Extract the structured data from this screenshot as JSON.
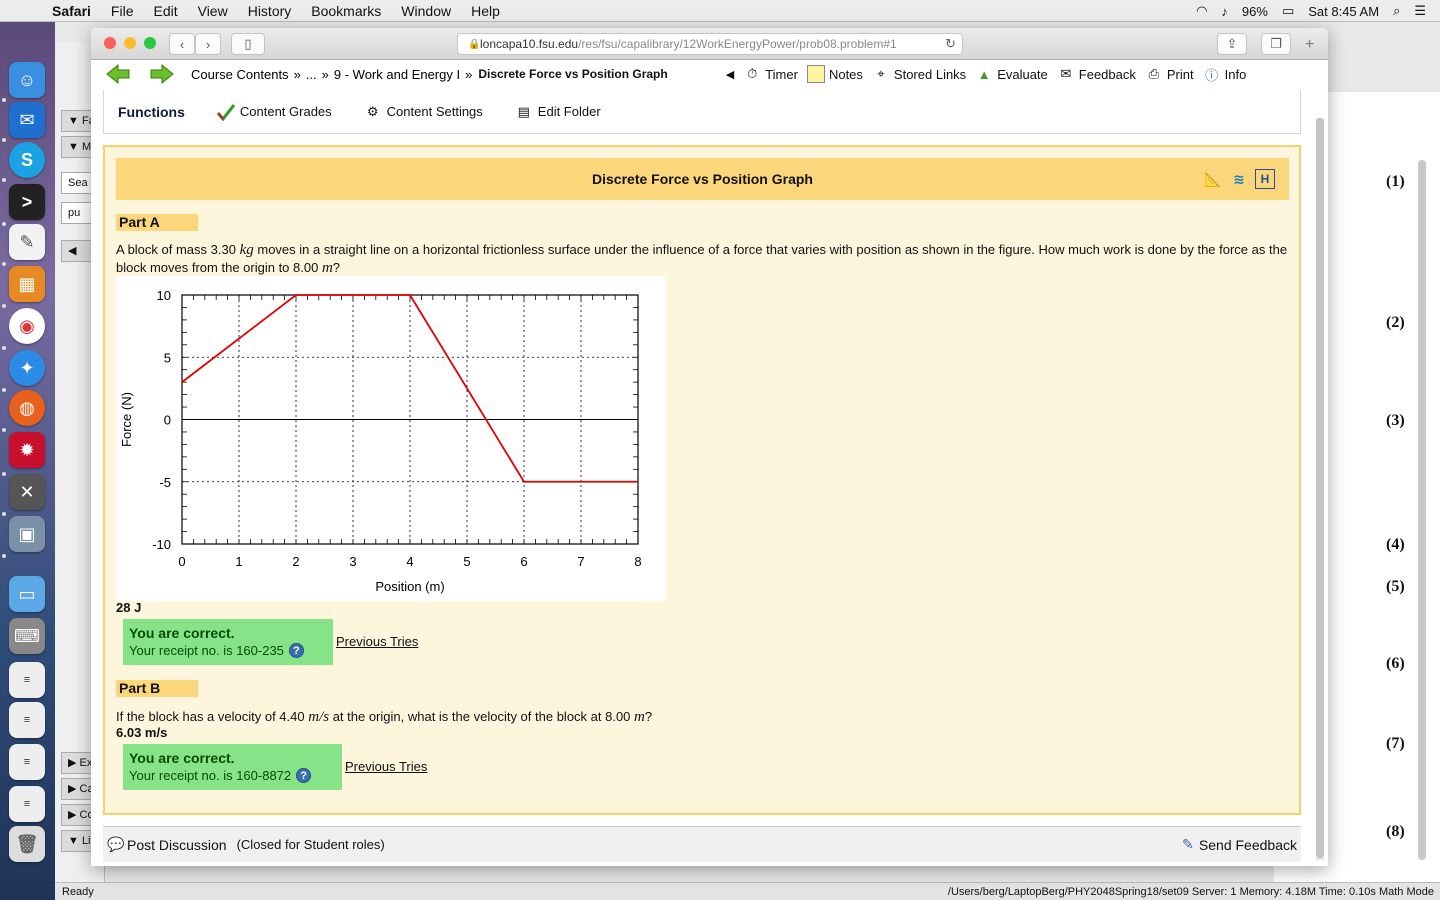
{
  "menubar": {
    "app": "Safari",
    "items": [
      "File",
      "Edit",
      "View",
      "History",
      "Bookmarks",
      "Window",
      "Help"
    ],
    "battery": "96%",
    "clock": "Sat 8:45 AM"
  },
  "browser": {
    "url_host": "loncapa10.fsu.edu",
    "url_path": "/res/fsu/capalibrary/12WorkEnergyPower/prob08.problem#1"
  },
  "nav": {
    "crumb1": "Course Contents",
    "crumb_sep": "»",
    "crumb_ellipsis": "...",
    "crumb2": "9 - Work and Energy I",
    "crumb_current": "Discrete Force vs Position Graph",
    "tools": {
      "timer": "Timer",
      "notes": "Notes",
      "stored_links": "Stored Links",
      "evaluate": "Evaluate",
      "feedback": "Feedback",
      "print": "Print",
      "info": "Info"
    }
  },
  "functions": {
    "title": "Functions",
    "content_grades": "Content Grades",
    "content_settings": "Content Settings",
    "edit_folder": "Edit Folder"
  },
  "problem": {
    "title": "Discrete Force vs Position Graph",
    "partA": {
      "label": "Part A",
      "text_1": "A block of mass 3.30 ",
      "unit_mass": "kg",
      "text_2": " moves in a straight line on a horizontal frictionless surface under the influence of a force that varies with position as shown in the figure. How much work is done by the force as the block moves from the origin to 8.00 ",
      "unit_len": "m",
      "text_3": "?",
      "answer": "28 J",
      "correct": "You are correct.",
      "receipt": "Your receipt no. is 160-235",
      "previous": "Previous Tries"
    },
    "partB": {
      "label": "Part B",
      "text_1": "If the block has a velocity of 4.40 ",
      "unit_vel": "m/s",
      "text_2": " at the origin, what is the velocity of the block at 8.00 ",
      "unit_len": "m",
      "text_3": "?",
      "answer": "6.03 m/s",
      "correct": "You are correct.",
      "receipt": "Your receipt no. is 160-8872",
      "previous": "Previous Tries"
    }
  },
  "chart_data": {
    "type": "line",
    "xlabel": "Position (m)",
    "ylabel": "Force (N)",
    "xlim": [
      0,
      8
    ],
    "ylim": [
      -10,
      10
    ],
    "xticks": [
      0,
      1,
      2,
      3,
      4,
      5,
      6,
      7,
      8
    ],
    "yticks": [
      10,
      5,
      0,
      -5,
      -10
    ],
    "grid": true,
    "series": [
      {
        "x": [
          0,
          2,
          4,
          6,
          8
        ],
        "y": [
          3,
          10,
          10,
          -5,
          -5
        ],
        "color": "#e00000"
      }
    ]
  },
  "footer": {
    "post_discussion": "Post Discussion",
    "closed": "(Closed for Student roles)",
    "send_feedback": "Send Feedback"
  },
  "background_window": {
    "question_numbers": [
      "(1)",
      "(2)",
      "(3)",
      "(4)",
      "(5)",
      "(6)",
      "(7)",
      "(8)"
    ],
    "status_left": "Ready",
    "status_right": "/Users/berg/LaptopBerg/PHY2048Spring18/set09   Server: 1   Memory: 4.18M   Time: 0.10s   Math Mode"
  },
  "colors": {
    "header_gold": "#fcd67a",
    "content_bg": "#fdf6dd",
    "correct_green": "#87e387",
    "plot_line": "#e00000"
  }
}
